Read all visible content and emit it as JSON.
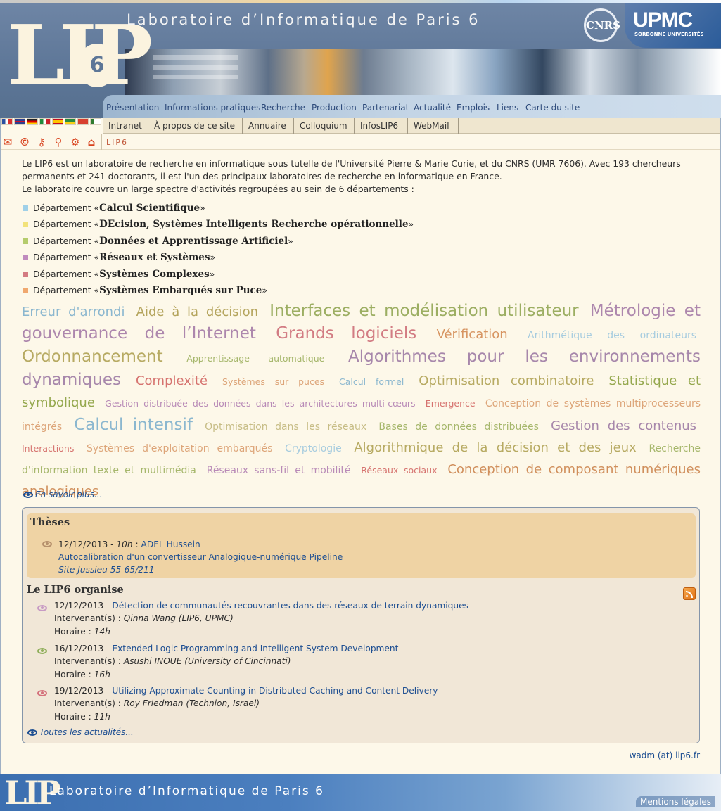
{
  "header": {
    "title": "Laboratoire d’Informatique de Paris 6",
    "logo_text": "LIP",
    "logo_digit": "6",
    "cnrs": "CNRS",
    "upmc": "UPMC",
    "upmc_sub": "SORBONNE UNIVERSITÉS"
  },
  "main_nav": [
    "Présentation",
    "Informations pratiques",
    "Recherche",
    "Production",
    "Partenariat",
    "Actualité",
    "Emplois",
    "Liens",
    "Carte du site"
  ],
  "sub_nav": [
    "Intranet",
    "À propos de ce site",
    "Annuaire",
    "Colloquium",
    "InfosLIP6",
    "WebMail"
  ],
  "breadcrumb": "LIP6",
  "intro": {
    "p1": "Le LIP6 est un laboratoire de recherche en informatique sous tutelle de l'Université Pierre & Marie Curie, et du CNRS (UMR 7606). Avec 193 chercheurs permanents et 241 doctorants, il est l'un des principaux laboratoires de recherche en informatique en France.",
    "p2": "Le laboratoire couvre un large spectre d'activités regroupées au sein de 6 départements :"
  },
  "departments": [
    {
      "prefix": "Département «",
      "name": "Calcul Scientifique",
      "suffix": "»",
      "color": "#9fd0e8"
    },
    {
      "prefix": "Département «",
      "name": "DEcision, Systèmes Intelligents Recherche opérationnelle",
      "suffix": "»",
      "color": "#f2e27a"
    },
    {
      "prefix": "Département «",
      "name": "Données et Apprentissage Artificiel",
      "suffix": "»",
      "color": "#b5cc6c"
    },
    {
      "prefix": "Département «",
      "name": "Réseaux et Systèmes",
      "suffix": "»",
      "color": "#c08bbd"
    },
    {
      "prefix": "Département «",
      "name": "Systèmes Complexes",
      "suffix": "»",
      "color": "#d47b82"
    },
    {
      "prefix": "Département «",
      "name": "Systèmes Embarqués sur Puce",
      "suffix": "»",
      "color": "#f0a86e"
    }
  ],
  "tag_cloud": [
    {
      "text": "Erreur d'arrondi",
      "size": 18,
      "color": "#8bb7cf"
    },
    {
      "text": "Aide à la décision",
      "size": 18,
      "color": "#b4a45c"
    },
    {
      "text": "Interfaces et modélisation utilisateur",
      "size": 23,
      "color": "#9cae62"
    },
    {
      "text": "Métrologie et gouvernance de l’Internet",
      "size": 23,
      "color": "#ad87ad"
    },
    {
      "text": "Grands logiciels",
      "size": 23,
      "color": "#d27c83"
    },
    {
      "text": "Vérification",
      "size": 18,
      "color": "#d79562"
    },
    {
      "text": "Arithmétique des ordinateurs",
      "size": 14,
      "color": "#a7ccdf"
    },
    {
      "text": "Ordonnancement",
      "size": 23,
      "color": "#b7aa62"
    },
    {
      "text": "Apprentissage automatique",
      "size": 12.5,
      "color": "#a6b76c"
    },
    {
      "text": "Algorithmes pour les environnements dynamiques",
      "size": 23,
      "color": "#a787ab"
    },
    {
      "text": "Complexité",
      "size": 18,
      "color": "#d6736f"
    },
    {
      "text": "Systèmes sur puces",
      "size": 12.5,
      "color": "#dda579"
    },
    {
      "text": "Calcul formel",
      "size": 12.5,
      "color": "#8bb7cf"
    },
    {
      "text": "Optimisation combinatoire",
      "size": 18,
      "color": "#b7aa62"
    },
    {
      "text": "Statistique et symbolique",
      "size": 18,
      "color": "#95a84e"
    },
    {
      "text": "Gestion distribuée des données dans les architectures multi-cœurs",
      "size": 12.5,
      "color": "#b88ab7"
    },
    {
      "text": "Emergence",
      "size": 12.5,
      "color": "#d6736f"
    },
    {
      "text": "Conception de systèmes multiprocesseurs intégrés",
      "size": 14,
      "color": "#dda579"
    },
    {
      "text": "Calcul intensif",
      "size": 23,
      "color": "#8bb7cf"
    },
    {
      "text": "Optimisation dans les réseaux",
      "size": 14,
      "color": "#c7bd86"
    },
    {
      "text": "Bases de données distribuées",
      "size": 14,
      "color": "#a6b76c"
    },
    {
      "text": "Gestion des contenus",
      "size": 18,
      "color": "#a787ab"
    },
    {
      "text": "Interactions",
      "size": 12.5,
      "color": "#d6736f"
    },
    {
      "text": "Systèmes d'exploitation embarqués",
      "size": 14,
      "color": "#dda579"
    },
    {
      "text": "Cryptologie",
      "size": 14,
      "color": "#a7ccdf"
    },
    {
      "text": "Algorithmique de la décision et des jeux",
      "size": 18,
      "color": "#b7aa62"
    },
    {
      "text": "Recherche d'information texte et multimédia",
      "size": 14,
      "color": "#a6b76c"
    },
    {
      "text": "Réseaux sans-fil et mobilité",
      "size": 14,
      "color": "#b88ab7"
    },
    {
      "text": "Réseaux sociaux",
      "size": 12.5,
      "color": "#d6736f"
    },
    {
      "text": "Conception de composant numériques analogiques",
      "size": 18,
      "color": "#d08f5c"
    }
  ],
  "more_link": "En savoir plus...",
  "theses": {
    "title": "Thèses",
    "date": "12/12/2013",
    "sep": " - ",
    "time": "10h",
    "colon": " : ",
    "name": "ADEL Hussein",
    "subject": "Autocalibration d'un convertisseur Analogique-numérique Pipeline",
    "location": "Site Jussieu 55-65/211"
  },
  "organise": {
    "title": "Le LIP6 organise",
    "speaker_label": "Intervenant(s) : ",
    "time_label": "Horaire : ",
    "events": [
      {
        "date": "12/12/2013 - ",
        "title": "Détection de communautés recouvrantes dans des réseaux de terrain dynamiques",
        "speaker": "Qinna Wang (LIP6, UPMC)",
        "time": "14h",
        "icon_color": "#c79ac4"
      },
      {
        "date": "16/12/2013 - ",
        "title": "Extended Logic Programming and Intelligent System Development",
        "speaker": "Asushi INOUE (University of Cincinnati)",
        "time": "16h",
        "icon_color": "#8fae5a"
      },
      {
        "date": "19/12/2013 - ",
        "title": "Utilizing Approximate Counting in Distributed Caching and Content Delivery",
        "speaker": "Roy Friedman (Technion, Israel)",
        "time": "11h",
        "icon_color": "#d4727c"
      }
    ]
  },
  "all_news": "Toutes les actualités...",
  "contact": "wadm (at) lip6.fr",
  "footer": {
    "logo_text": "LIP",
    "title": "Laboratoire d’Informatique de Paris 6",
    "legal": "Mentions légales"
  }
}
